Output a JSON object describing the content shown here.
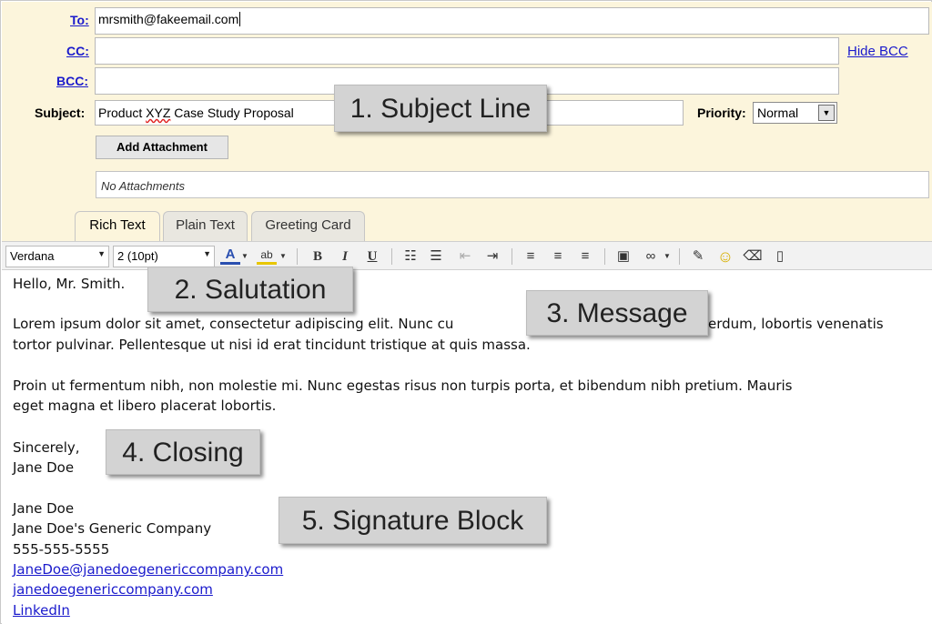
{
  "fields": {
    "to_label": "To:",
    "to_value": "mrsmith@fakeemail.com",
    "cc_label": "CC:",
    "cc_value": "",
    "bcc_label": "BCC:",
    "bcc_value": "",
    "hide_bcc": "Hide BCC",
    "subject_label": "Subject:",
    "subject_prefix": "Product ",
    "subject_misspelled": "XYZ",
    "subject_suffix": " Case Study Proposal",
    "priority_label": "Priority:",
    "priority_value": "Normal"
  },
  "attachments": {
    "button_label": "Add Attachment",
    "status": "No Attachments"
  },
  "tabs": [
    {
      "label": "Rich Text",
      "active": true
    },
    {
      "label": "Plain Text",
      "active": false
    },
    {
      "label": "Greeting Card",
      "active": false
    }
  ],
  "toolbar": {
    "font": "Verdana",
    "size": "2 (10pt)",
    "font_color_glyph": "A",
    "bold": "B",
    "italic": "I",
    "underline": "U"
  },
  "body": {
    "salutation": "Hello, Mr. Smith.",
    "para1_line1": "Lorem ipsum dolor sit amet, consectetur adipiscing elit. Nunc cu",
    "para1_line1_tail": "erdum, lobortis venenatis",
    "para1_line2": "tortor pulvinar. Pellentesque ut nisi id erat tincidunt tristique at quis massa.",
    "para2_line1": "Proin ut fermentum nibh, non molestie mi. Nunc egestas risus non turpis porta, et bibendum nibh pretium. Mauris",
    "para2_line2": "eget magna et libero placerat lobortis.",
    "closing": "Sincerely,",
    "closing_name": "Jane Doe",
    "sig_name": "Jane Doe",
    "sig_company": "Jane Doe's Generic Company",
    "sig_phone": "555-555-5555",
    "sig_email": "JaneDoe@janedoegenericcompany.com",
    "sig_website": "janedoegenericcompany.com",
    "sig_linkedin": "LinkedIn"
  },
  "callouts": {
    "subject": "1. Subject Line",
    "salutation": "2. Salutation",
    "message": "3. Message",
    "closing": "4. Closing",
    "signature": "5. Signature Block"
  },
  "colors": {
    "header_bg": "#fcf5dc",
    "link": "#1a1acc",
    "callout_bg": "#d3d3d3"
  }
}
